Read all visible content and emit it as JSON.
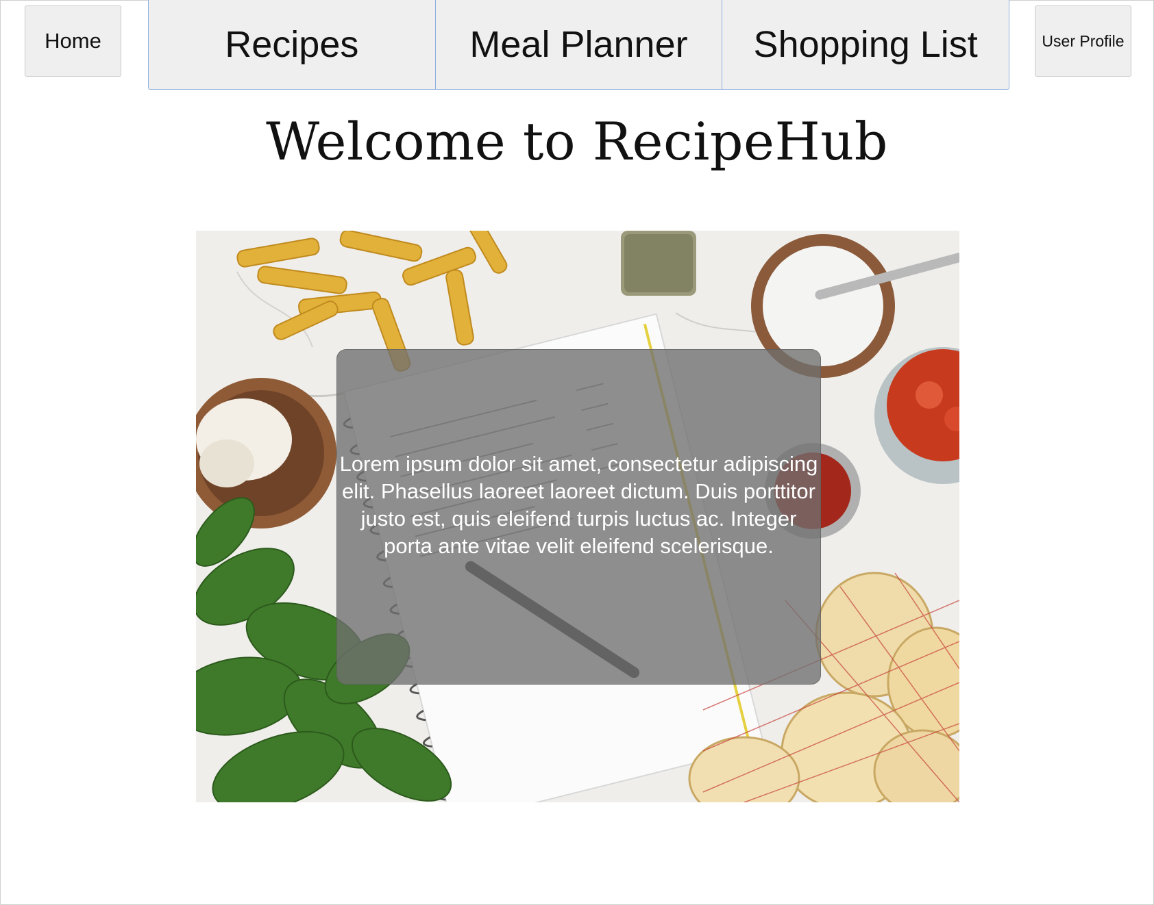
{
  "nav": {
    "home_label": "Home",
    "tabs": [
      {
        "label": "Recipes"
      },
      {
        "label": "Meal Planner"
      },
      {
        "label": "Shopping List"
      }
    ],
    "profile_label": "User Profile"
  },
  "header": {
    "title": "Welcome to RecipeHub"
  },
  "hero": {
    "image_icon": "food-ingredients-photo",
    "overlay_text": "Lorem ipsum dolor sit amet, consectetur adipiscing elit. Phasellus laoreet laoreet dictum. Duis porttitor justo est, quis eleifend turpis luctus ac. Integer porta ante vitae velit eleifend scelerisque."
  },
  "colors": {
    "nav_background": "#efefef",
    "tab_border": "#8fb0e0",
    "overlay": "#707070"
  }
}
